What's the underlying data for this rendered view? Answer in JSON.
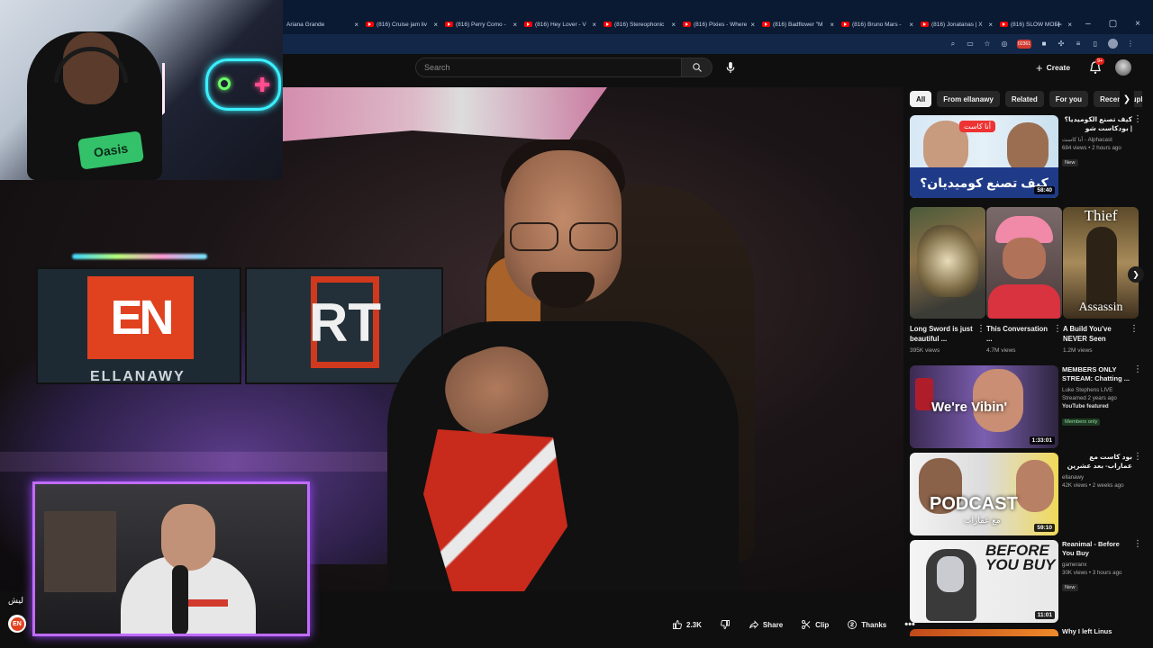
{
  "browser": {
    "tabs": [
      {
        "label": "Ariana Grande"
      },
      {
        "label": "(816) Cruise jam liv"
      },
      {
        "label": "(816) Perry Como -"
      },
      {
        "label": "(816) Hey Lover - V"
      },
      {
        "label": "(816) Stereophonic"
      },
      {
        "label": "(816) Pixies - Where"
      },
      {
        "label": "(816) Badflower \"M"
      },
      {
        "label": "(816) Bruno Mars -"
      },
      {
        "label": "(816) Jonatanas | X"
      },
      {
        "label": "(816) SLOW MOE -"
      }
    ],
    "close_glyph": "×",
    "new_tab_glyph": "+",
    "window_controls": [
      "–",
      "▢",
      "×"
    ],
    "rec_badge": "02361"
  },
  "header": {
    "search_placeholder": "Search",
    "create_label": "Create",
    "notification_count": "9+"
  },
  "overlay": {
    "caption": "ليش",
    "badge_text": "EN"
  },
  "video_art": {
    "logo_en": "EN",
    "logo_en_label": "ELLANAWY",
    "logo_rt": "RT",
    "cam_logo": "Oasis"
  },
  "actions": {
    "like_count": "2.3K",
    "share": "Share",
    "clip": "Clip",
    "thanks": "Thanks"
  },
  "chips": [
    {
      "label": "All",
      "active": true
    },
    {
      "label": "From ellanawy"
    },
    {
      "label": "Related"
    },
    {
      "label": "For you"
    },
    {
      "label": "Recently uploaded"
    }
  ],
  "recommendations": [
    {
      "title": "كيف تصنع الكوميديا؟ | بودكاست شو الكوميديا مع",
      "channel": "Alphacast - أنا كاست",
      "stats": "684 views • 2 hours ago",
      "badge": "New",
      "duration": "58:40",
      "thumb_caption": "كيف تصنع كوميديان؟",
      "thumb_bubble": "أنا كاست"
    },
    {
      "title": "MEMBERS ONLY STREAM: Chatting ...",
      "channel": "Luke Stephens LIVE",
      "stats": "Streamed 2 years ago",
      "featured": "YouTube featured",
      "members": "Members only",
      "duration": "1:33:01",
      "thumb_text": "We're Vibin'"
    },
    {
      "title": "بود كاست مع عماراب- بعد عشرين سنه في مجال الراب",
      "channel": "ellanawy",
      "stats": "42K views • 2 weeks ago",
      "duration": "59:10",
      "thumb_text": "PODCAST",
      "thumb_sub": "مع عماراب"
    },
    {
      "title": "Reanimal - Before You Buy",
      "channel": "gameranx",
      "stats": "30K views • 3 hours ago",
      "badge": "New",
      "duration": "11:01",
      "thumb_text": "BEFORE YOU BUY"
    }
  ],
  "shorts": [
    {
      "title": "Long Sword is just beautiful ...",
      "views": "395K views"
    },
    {
      "title": "This Conversation ...",
      "views": "4.7M views"
    },
    {
      "title": "A Build You've NEVER Seen",
      "views": "1.2M views",
      "thumb_top": "Thief",
      "thumb_bottom": "Assassin"
    }
  ],
  "last_item": {
    "title": "Why I left Linus"
  }
}
